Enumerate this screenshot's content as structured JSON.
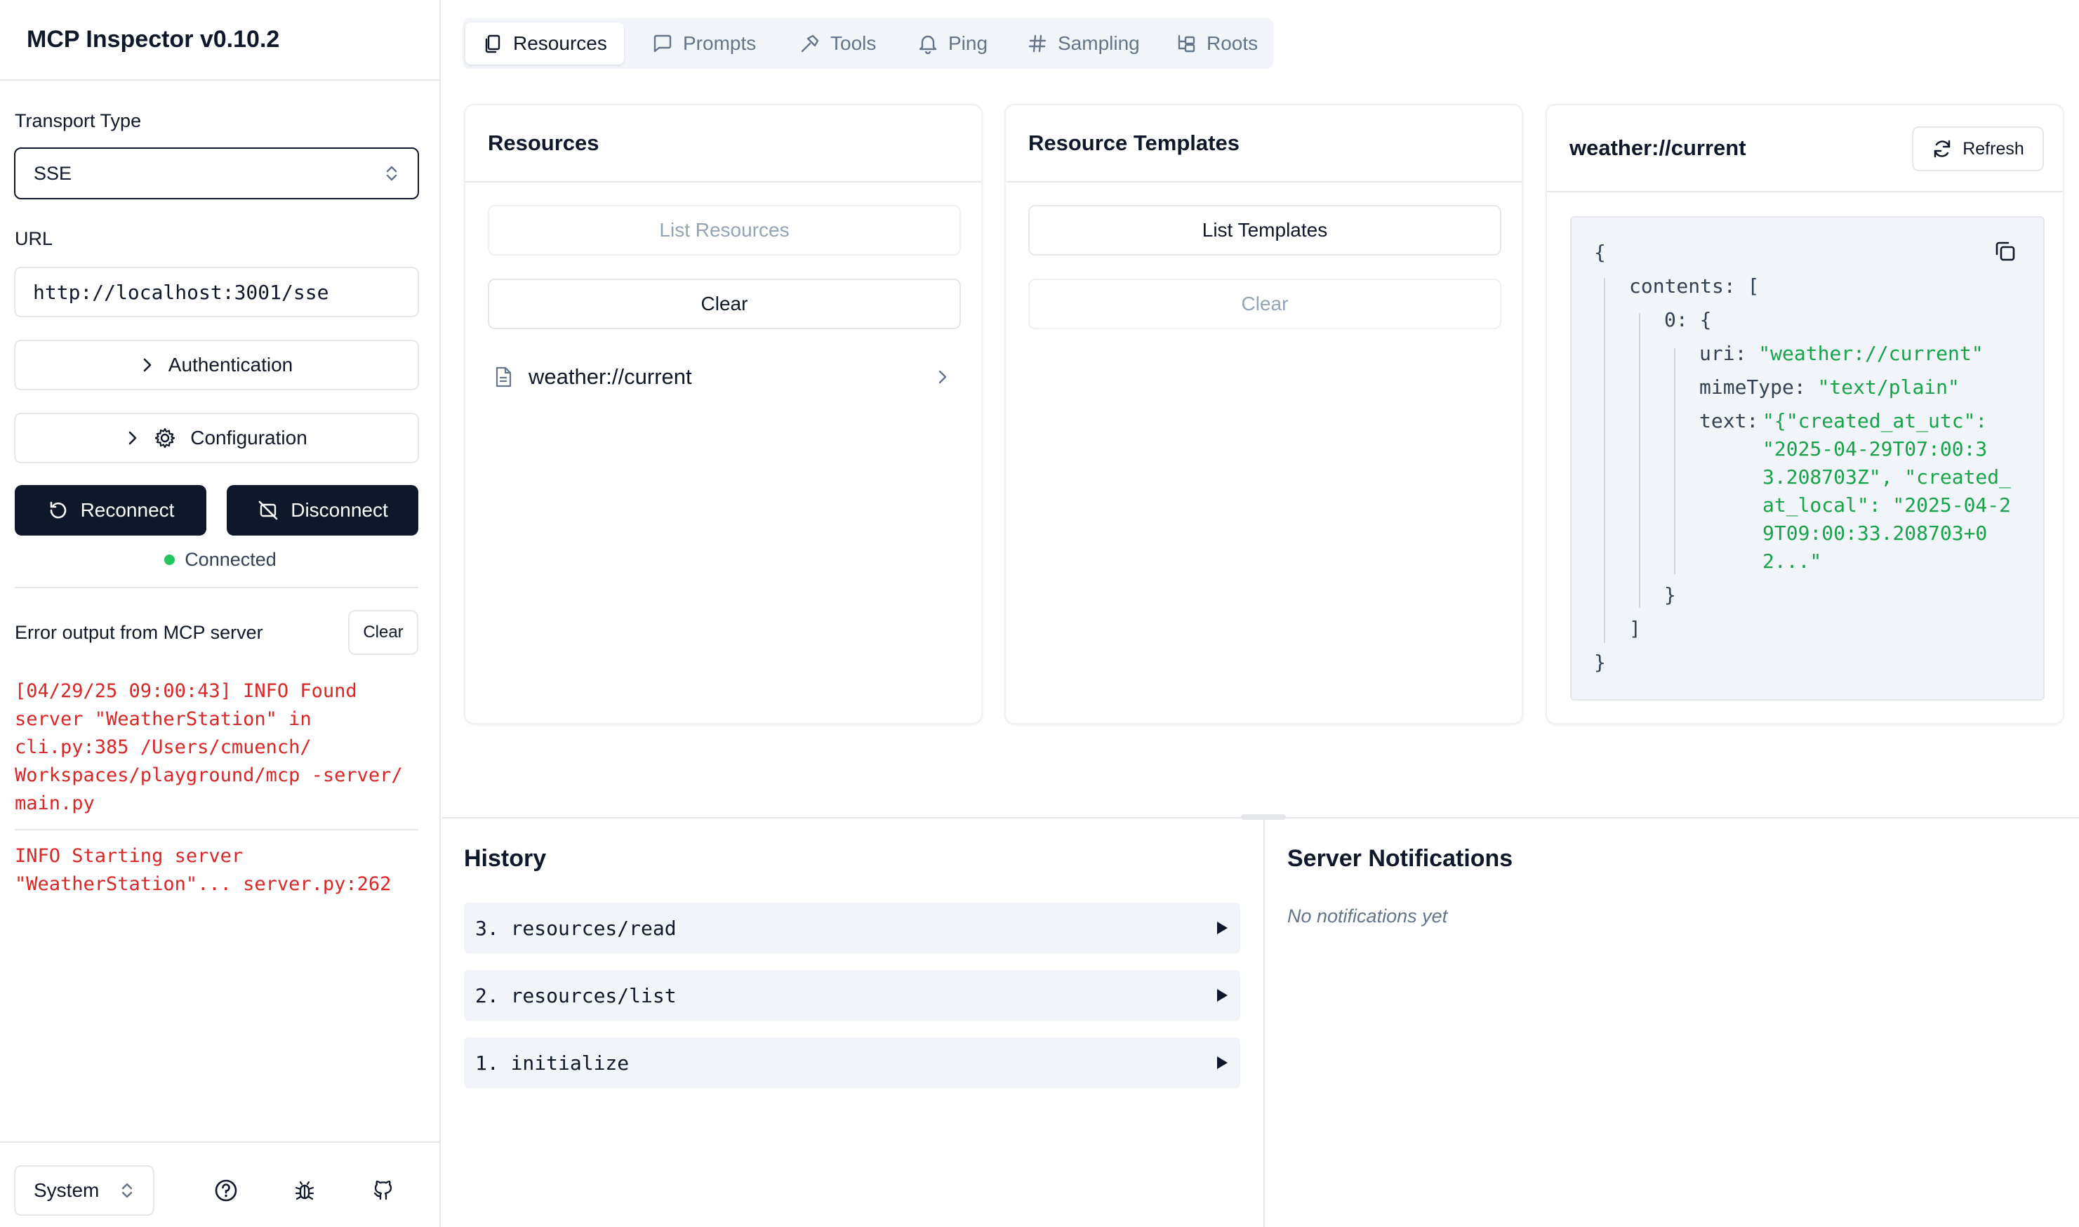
{
  "app": {
    "title": "MCP Inspector v0.10.2"
  },
  "sidebar": {
    "transport_label": "Transport Type",
    "transport_value": "SSE",
    "url_label": "URL",
    "url_value": "http://localhost:3001/sse",
    "auth_label": "Authentication",
    "config_label": "Configuration",
    "reconnect_label": "Reconnect",
    "disconnect_label": "Disconnect",
    "status_text": "Connected",
    "error_title": "Error output from MCP server",
    "clear_label": "Clear",
    "errors": [
      "[04/29/25 09:00:43] INFO Found\nserver \"WeatherStation\" in\ncli.py:385 /Users/cmuench/\nWorkspaces/playground/mcp -server/\nmain.py",
      "INFO Starting server\n\"WeatherStation\"... server.py:262"
    ],
    "theme_value": "System"
  },
  "tabs": [
    {
      "label": "Resources",
      "icon": "files-icon"
    },
    {
      "label": "Prompts",
      "icon": "message-square-icon"
    },
    {
      "label": "Tools",
      "icon": "hammer-icon"
    },
    {
      "label": "Ping",
      "icon": "bell-icon"
    },
    {
      "label": "Sampling",
      "icon": "hash-icon"
    },
    {
      "label": "Roots",
      "icon": "folder-tree-icon"
    }
  ],
  "resources": {
    "title": "Resources",
    "list_label": "List Resources",
    "clear_label": "Clear",
    "items": [
      {
        "uri": "weather://current"
      }
    ]
  },
  "templates": {
    "title": "Resource Templates",
    "list_label": "List Templates",
    "clear_label": "Clear"
  },
  "detail": {
    "title": "weather://current",
    "refresh_label": "Refresh",
    "json": {
      "open": "{",
      "contents_key": "contents:",
      "contents_open": "[",
      "index_key": "0:",
      "index_open": "{",
      "uri_key": "uri:",
      "uri_val": "\"weather://current\"",
      "mime_key": "mimeType:",
      "mime_val": "\"text/plain\"",
      "text_key": "text:",
      "text_lines": [
        "\"{\"created_at_utc\":",
        "\"2025-04-29T07:00:3",
        "3.208703Z\", \"created_",
        "at_local\": \"2025-04-2",
        "9T09:00:33.208703+0",
        "2...\""
      ],
      "index_close": "}",
      "contents_close": "]",
      "close": "}"
    }
  },
  "history": {
    "title": "History",
    "items": [
      {
        "label": "3.  resources/read"
      },
      {
        "label": "2.  resources/list"
      },
      {
        "label": "1.  initialize"
      }
    ]
  },
  "notifications": {
    "title": "Server Notifications",
    "empty_text": "No notifications yet"
  }
}
